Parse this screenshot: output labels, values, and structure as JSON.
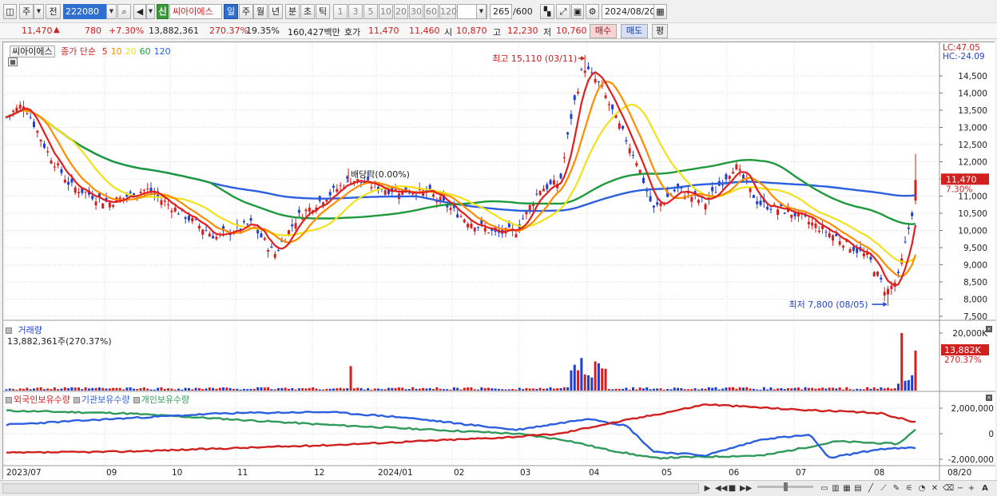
{
  "toolbar": {
    "btn_ju": "주",
    "btn_jeon": "전",
    "code": "222080",
    "new_badge": "신",
    "stock_name": "씨아이에스",
    "periods": [
      "일",
      "주",
      "월",
      "년",
      "분",
      "초",
      "틱"
    ],
    "intervals": [
      "1",
      "3",
      "5",
      "10",
      "20",
      "30",
      "60",
      "120"
    ],
    "count": "265",
    "count_total": "/600",
    "date": "2024/08/20"
  },
  "quote": {
    "price": "11,470",
    "arrow": "▲",
    "change": "780",
    "change_pct": "+7.30%",
    "volume": "13,882,361",
    "volume_pct": "270.37%",
    "turnover": "19.35%",
    "amount": "160,427백만",
    "hoga_label": "호가",
    "ask": "11,470",
    "bid": "11,460",
    "open_label": "시",
    "open": "10,870",
    "high_label": "고",
    "high": "12,230",
    "low_label": "저",
    "low": "10,760",
    "buy_btn": "매수",
    "sell_btn": "매도",
    "avg_btn": "평"
  },
  "price_panel": {
    "name": "씨아이에스",
    "ma_title": "종가 단순",
    "ma_periods": [
      "5",
      "10",
      "20",
      "60",
      "120"
    ],
    "ma_colors": [
      "#e0201f",
      "#ff8c00",
      "#f2e11a",
      "#1e9a3c",
      "#2b5fe0"
    ],
    "lc": "LC:47.05",
    "hc": "HC:-24.09",
    "max_label": "최고 15,110 (03/11)",
    "min_label": "최저 7,800 (08/05)",
    "dividend_label": "배당락(0.00%)",
    "price_badge": "11,470",
    "pct_badge": "7.30%",
    "y_ticks": [
      "14,500",
      "14,000",
      "13,500",
      "13,000",
      "12,500",
      "12,000",
      "11,500",
      "11,000",
      "10,500",
      "10,000",
      "9,500",
      "9,000",
      "8,500",
      "8,000",
      "7,500"
    ]
  },
  "volume_panel": {
    "title": "거래량",
    "value": "13,882,361주(270.37%)",
    "axis_max": "20,000K",
    "badge": "13,882K",
    "badge_pct": "270.37%"
  },
  "holding_panel": {
    "series_names": [
      "외국인보유수량",
      "기관보유수량",
      "개인보유수량"
    ],
    "series_colors": [
      "#d0201f",
      "#2b5fe0",
      "#2f9a5a"
    ],
    "y_ticks": [
      "2,000,000",
      "0",
      "-2,000,000"
    ]
  },
  "x_axis": {
    "labels": [
      "2023/07",
      "09",
      "10",
      "11",
      "12",
      "2024/01",
      "02",
      "03",
      "04",
      "05",
      "06",
      "07",
      "08",
      "08/20"
    ]
  },
  "colors": {
    "up": "#d0201f",
    "down": "#1f3fd0",
    "accent_blue": "#2f6fd0"
  }
}
